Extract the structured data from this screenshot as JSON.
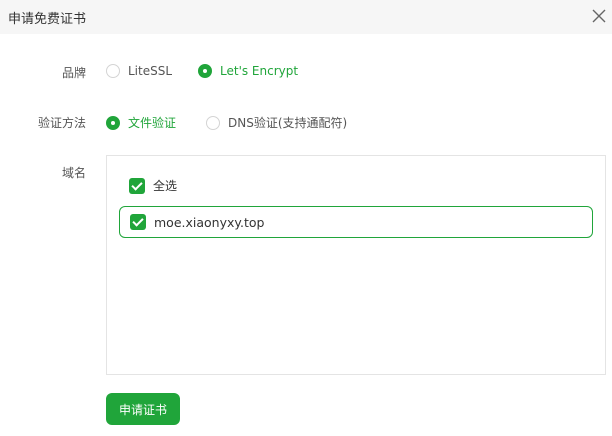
{
  "dialog": {
    "title": "申请免费证书"
  },
  "form": {
    "brand": {
      "label": "品牌",
      "options": [
        {
          "label": "LiteSSL",
          "checked": false
        },
        {
          "label": "Let's Encrypt",
          "checked": true
        }
      ]
    },
    "method": {
      "label": "验证方法",
      "options": [
        {
          "label": "文件验证",
          "checked": true
        },
        {
          "label": "DNS验证(支持通配符)",
          "checked": false
        }
      ]
    },
    "domains": {
      "label": "域名",
      "select_all_label": "全选",
      "select_all_checked": true,
      "items": [
        {
          "name": "moe.xiaonyxy.top",
          "checked": true
        }
      ]
    }
  },
  "submit_label": "申请证书",
  "colors": {
    "accent": "#20a53a",
    "titlebar_bg": "#f6f6f6",
    "border": "#e4e4e4"
  },
  "icons": {
    "close": "close-icon",
    "check": "checkmark-icon"
  }
}
